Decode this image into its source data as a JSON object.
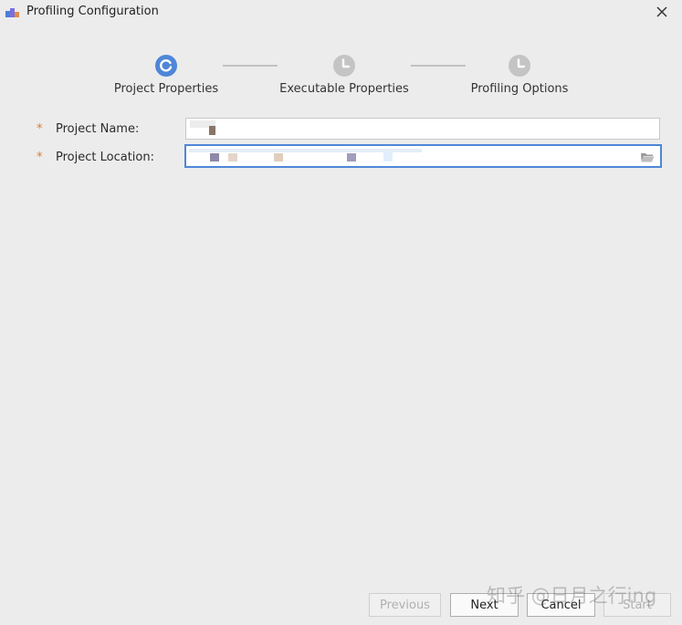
{
  "window": {
    "title": "Profiling Configuration"
  },
  "steps": [
    {
      "label": "Project Properties",
      "state": "active"
    },
    {
      "label": "Executable Properties",
      "state": "pending"
    },
    {
      "label": "Profiling Options",
      "state": "pending"
    }
  ],
  "form": {
    "project_name": {
      "label": "Project Name:",
      "required_marker": "*",
      "value": ""
    },
    "project_location": {
      "label": "Project Location:",
      "required_marker": "*",
      "value": ""
    }
  },
  "buttons": {
    "previous": "Previous",
    "next": "Next",
    "cancel": "Cancel",
    "start": "Start"
  },
  "watermark": "知乎 @日月之行ing",
  "colors": {
    "accent": "#4f86d8",
    "required": "#e07a32",
    "pending_step": "#c4c4c4"
  }
}
